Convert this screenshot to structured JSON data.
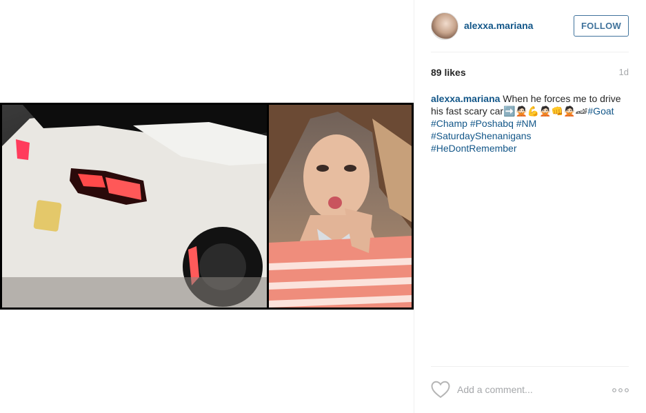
{
  "post": {
    "image": {
      "description": "collage-image",
      "panels": [
        "car-rear-photo",
        "selfie-photo"
      ]
    }
  },
  "header": {
    "username": "alexxa.mariana",
    "follow_label": "FOLLOW"
  },
  "stats": {
    "likes": "89 likes",
    "age": "1d"
  },
  "caption": {
    "username": "alexxa.mariana",
    "text": "When he forces me to drive his fast scary car➡️🙅🏻💪🙅🏻👊🙅🏻🏎",
    "hashtags": [
      "#Goat",
      "#Champ",
      "#Poshabq",
      "#NM",
      "#SaturdayShenanigans",
      "#HeDontRemember"
    ]
  },
  "footer": {
    "comment_placeholder": "Add a comment...",
    "icons": {
      "like": "heart-icon",
      "more": "more-options-icon"
    }
  },
  "colors": {
    "link": "#125688",
    "button": "#3f729b",
    "muted": "#a5a7aa",
    "divider": "#efefef"
  }
}
